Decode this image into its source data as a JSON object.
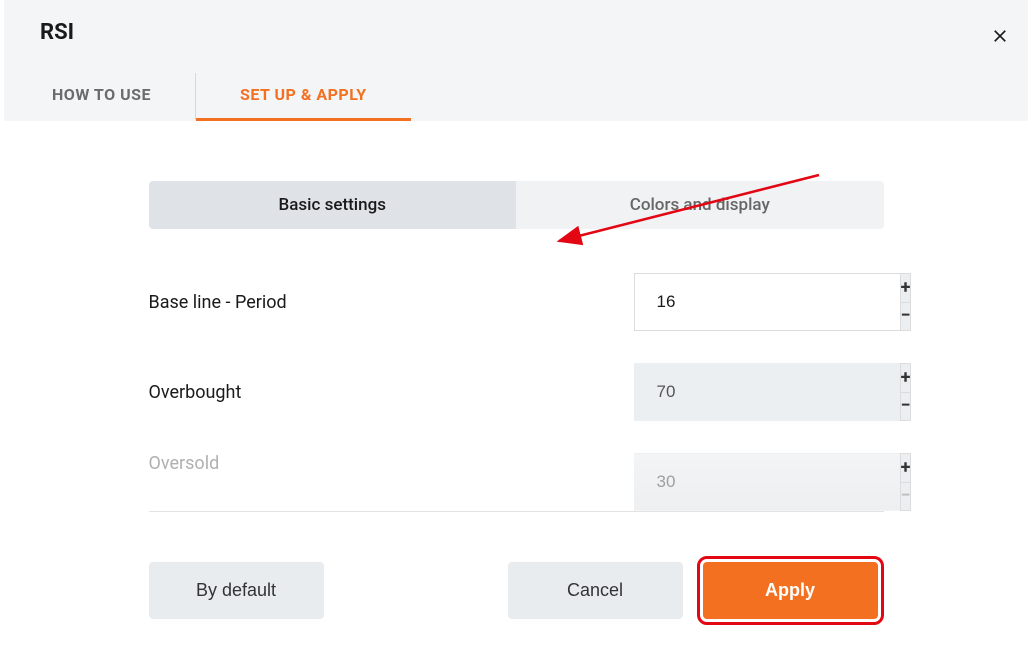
{
  "header": {
    "title": "RSI",
    "close_icon": "close"
  },
  "tabs": [
    {
      "label": "HOW TO USE",
      "active": false
    },
    {
      "label": "SET UP & APPLY",
      "active": true
    }
  ],
  "subtabs": [
    {
      "label": "Basic settings",
      "active": true
    },
    {
      "label": "Colors and display",
      "active": false
    }
  ],
  "fields": {
    "baseline": {
      "label": "Base line - Period",
      "value": "16"
    },
    "overbought": {
      "label": "Overbought",
      "value": "70"
    },
    "oversold": {
      "label": "Oversold",
      "value": "30"
    }
  },
  "buttons": {
    "default": "By default",
    "cancel": "Cancel",
    "apply": "Apply"
  },
  "colors": {
    "accent": "#f37021",
    "highlight": "#e30613"
  }
}
